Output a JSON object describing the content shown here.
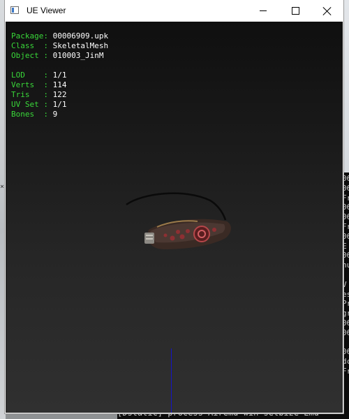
{
  "window": {
    "title": "UE Viewer"
  },
  "info": {
    "rows": [
      {
        "key": "Package",
        "value": "00006909.upk"
      },
      {
        "key": "Class  ",
        "value": "SkeletalMesh"
      },
      {
        "key": "Object ",
        "value": "010003_JinM"
      }
    ],
    "stats": [
      {
        "key": "LOD    ",
        "value": "1/1"
      },
      {
        "key": "Verts  ",
        "value": "114"
      },
      {
        "key": "Tris   ",
        "value": "122"
      },
      {
        "key": "UV Set ",
        "value": "1/1"
      },
      {
        "key": "Bones  ",
        "value": "9"
      }
    ]
  },
  "console": {
    "right_fragments": [
      "06",
      "06",
      "Fr",
      "06",
      "06",
      "Fr",
      "06",
      "E",
      "06",
      "nu",
      "",
      "V",
      "es",
      "Pr",
      "gr",
      "06",
      "06",
      "",
      "06",
      "dc",
      "Fr"
    ],
    "bottom_text": "[Dstatic] process  Airemd win setbize  Emd"
  },
  "colors": {
    "key_text": "#39d739",
    "value_text": "#ffffff",
    "axis_line": "#1414c8"
  }
}
